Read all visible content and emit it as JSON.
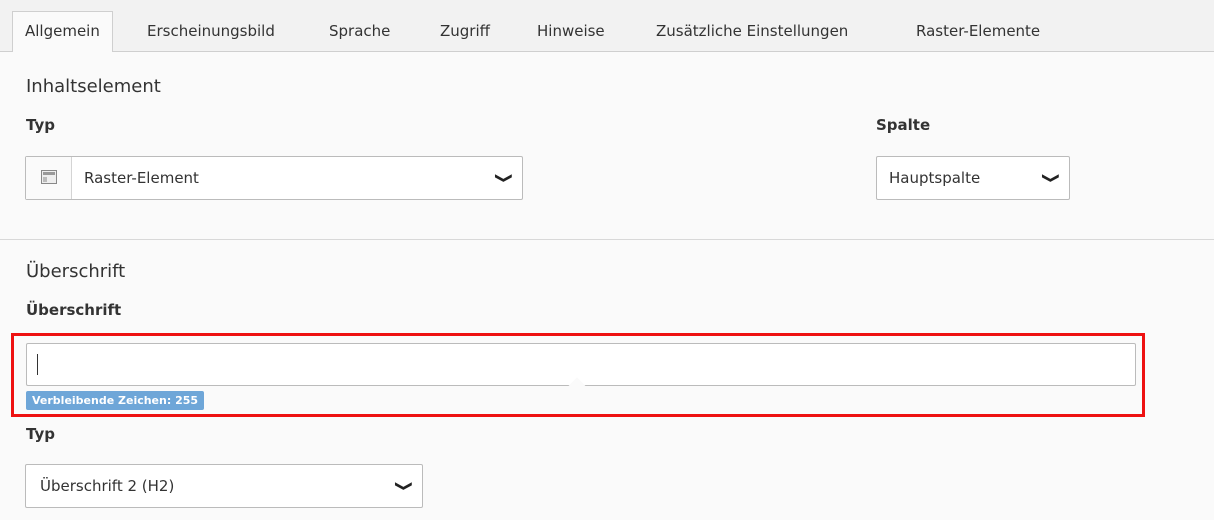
{
  "tabs": [
    {
      "label": "Allgemein",
      "active": true
    },
    {
      "label": "Erscheinungsbild",
      "active": false
    },
    {
      "label": "Sprache",
      "active": false
    },
    {
      "label": "Zugriff",
      "active": false
    },
    {
      "label": "Hinweise",
      "active": false
    },
    {
      "label": "Zusätzliche Einstellungen",
      "active": false
    },
    {
      "label": "Raster-Elemente",
      "active": false
    }
  ],
  "content_element": {
    "section_title": "Inhaltselement",
    "type_label": "Typ",
    "type_value": "Raster-Element",
    "type_icon": "grid-element-icon",
    "column_label": "Spalte",
    "column_value": "Hauptspalte"
  },
  "header_section": {
    "section_title": "Überschrift",
    "header_label": "Überschrift",
    "header_value": "",
    "remaining_chars": "Verbleibende Zeichen: 255",
    "type_label": "Typ",
    "type_value": "Überschrift 2 (H2)"
  },
  "colors": {
    "highlight_border": "#e11111",
    "badge_bg": "#6ea6d8"
  }
}
